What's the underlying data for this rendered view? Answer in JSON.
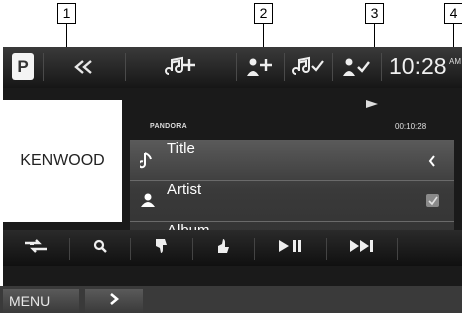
{
  "callouts": [
    "1",
    "2",
    "3",
    "4"
  ],
  "topbar": {
    "source_button": "P",
    "clock_time": "10:28",
    "clock_ampm": "AM",
    "buttons": [
      "back-icon",
      "thumb-up-note-icon",
      "thumb-up-artist-icon",
      "thumb-down-note-icon",
      "thumb-down-artist-icon"
    ]
  },
  "artwork": {
    "label": "KENWOOD"
  },
  "status": {
    "source_name": "PANDORA",
    "play_state": "play-indicator-icon",
    "playing_time": "00:10:28"
  },
  "info_rows": [
    {
      "icon": "music-note-icon",
      "label": "Title",
      "right": "chevron-left-icon"
    },
    {
      "icon": "person-icon",
      "label": "Artist",
      "right": "check-icon"
    },
    {
      "icon": "disc-icon",
      "label": "Album",
      "right": "chevron-left-icon"
    }
  ],
  "bottombar": {
    "buttons": [
      "shuffle-source-icon",
      "search-icon",
      "thumb-down-icon",
      "thumb-up-icon",
      "play-pause-icon",
      "skip-forward-icon"
    ]
  },
  "menu": {
    "menu_label": "MENU",
    "chevron": "chevron-right-icon"
  },
  "colors": {
    "screen": "#1a1a1a",
    "panel": "#3a3a3a",
    "text": "#ffffff",
    "art": "#ffffff"
  }
}
